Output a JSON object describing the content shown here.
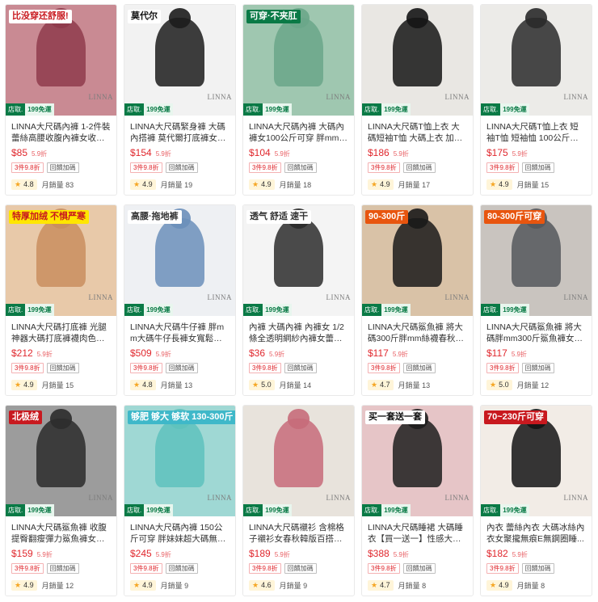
{
  "shop_badge": {
    "prefix": "店取.",
    "suffix": "199免運"
  },
  "watermark": "LINNA",
  "sold_prefix": "月銷量",
  "products": [
    {
      "title": "LINNA大尺碼內褲 1-2件裝 蕾絲高腰收腹內褲女收小肚...",
      "price": "$85",
      "discount": "5.9折",
      "tags": [
        "3件9.8折",
        "回饋加碼"
      ],
      "rating": "4.8",
      "sold": "83",
      "promo": "比没穿还舒服!",
      "bg": "#c98a93",
      "fg": "#8f3b4c",
      "promo_bg": "#ffffff",
      "promo_fg": "#c8191f"
    },
    {
      "title": "LINNA大尺碼緊身褲 大碼內搭褲 莫代爾打底褲女新款夏...",
      "price": "$154",
      "discount": "5.9折",
      "tags": [
        "3件9.8折",
        "回饋加碼"
      ],
      "rating": "4.9",
      "sold": "19",
      "promo": "莫代尔",
      "bg": "#f2f2f2",
      "fg": "#1c1c1c",
      "promo_bg": "#ffffff",
      "promo_fg": "#111111"
    },
    {
      "title": "LINNA大尺碼內褲 大碼內褲女100公斤可穿 胖mm夏季...",
      "price": "$104",
      "discount": "5.9折",
      "tags": [
        "3件9.8折",
        "回饋加碼"
      ],
      "rating": "4.9",
      "sold": "18",
      "promo": "可穿·不夹肛",
      "bg": "#9fc7b0",
      "fg": "#6aa68a",
      "promo_bg": "#0a7a46",
      "promo_fg": "#ffffff"
    },
    {
      "title": "LINNA大尺碼T恤上衣 大碼短袖T恤 大碼上衣 加大短袖...",
      "price": "$186",
      "discount": "5.9折",
      "tags": [
        "3件9.8折",
        "回饋加碼"
      ],
      "rating": "4.9",
      "sold": "17",
      "promo": "",
      "bg": "#e9e7e3",
      "fg": "#151515",
      "promo_bg": "#ffffff",
      "promo_fg": "#111111"
    },
    {
      "title": "LINNA大尺碼T恤上衣 短袖T恤 短袖恤 100公斤將大碼寬...",
      "price": "$175",
      "discount": "5.9折",
      "tags": [
        "3件9.8折",
        "回饋加碼"
      ],
      "rating": "4.9",
      "sold": "15",
      "promo": "",
      "bg": "#ecebe8",
      "fg": "#2a2a2a",
      "promo_bg": "#ffffff",
      "promo_fg": "#111111"
    },
    {
      "title": "LINNA大尺碼打底褲 光腿神器大碼打底褲襪肉色不規則...",
      "price": "$212",
      "discount": "5.9折",
      "tags": [
        "3件9.8折",
        "回饋加碼"
      ],
      "rating": "4.9",
      "sold": "15",
      "promo": "特厚加绒 不惧严寒",
      "bg": "#e8c9a9",
      "fg": "#c98e5f",
      "promo_bg": "#ffe600",
      "promo_fg": "#c8191f"
    },
    {
      "title": "LINNA大尺碼牛仔褲 胖mm大碼牛仔長褲女寬鬆顯高...",
      "price": "$509",
      "discount": "5.9折",
      "tags": [
        "3件9.8折",
        "回饋加碼"
      ],
      "rating": "4.8",
      "sold": "13",
      "promo": "高腰·拖地裤",
      "bg": "#eef0f3",
      "fg": "#6b8fba",
      "promo_bg": "#ffffff",
      "promo_fg": "#333333"
    },
    {
      "title": "內褲 大碼內褲 內褲女 1/2條全透明網紗內褲女蕾絲超...",
      "price": "$36",
      "discount": "5.9折",
      "tags": [
        "3件9.8折",
        "回饋加碼"
      ],
      "rating": "5.0",
      "sold": "14",
      "promo": "透气 舒适 速干",
      "bg": "#f4f4f4",
      "fg": "#2b2b2b",
      "promo_bg": "#ffffff",
      "promo_fg": "#333333"
    },
    {
      "title": "LINNA大尺碼鯊魚褲 將大碼300斤胖mm絲襪春秋薄款...",
      "price": "$117",
      "discount": "5.9折",
      "tags": [
        "3件9.8折",
        "回饋加碼"
      ],
      "rating": "4.7",
      "sold": "13",
      "promo": "90-300斤",
      "bg": "#d9c2a7",
      "fg": "#1a1a1a",
      "promo_bg": "#e8550f",
      "promo_fg": "#ffffff"
    },
    {
      "title": "LINNA大尺碼鯊魚褲 將大碼胖mm300斤鯊魚褲女外穿...",
      "price": "$117",
      "discount": "5.9折",
      "tags": [
        "3件9.8折",
        "回饋加碼"
      ],
      "rating": "5.0",
      "sold": "12",
      "promo": "80-300斤可穿",
      "bg": "#c9c4bf",
      "fg": "#55585c",
      "promo_bg": "#e8550f",
      "promo_fg": "#ffffff"
    },
    {
      "title": "LINNA大尺碼鯊魚褲 收腹提臀翻瘦彈力鯊魚褲女春夏...",
      "price": "$159",
      "discount": "5.9折",
      "tags": [
        "3件9.8折",
        "回饋加碼"
      ],
      "rating": "4.9",
      "sold": "12",
      "promo": "北极绒",
      "bg": "#9c9c9c",
      "fg": "#2c2c2c",
      "promo_bg": "#c8191f",
      "promo_fg": "#ffffff"
    },
    {
      "title": "LINNA大尺碼內褲 150公斤可穿 胖妹妹超大碼無痕莫...",
      "price": "$245",
      "discount": "5.9折",
      "tags": [
        "3件9.8折",
        "回饋加碼"
      ],
      "rating": "4.9",
      "sold": "9",
      "promo": "够肥 够大 够软 130-300斤",
      "bg": "#9fd8d4",
      "fg": "#5ec2bd",
      "promo_bg": "#3fb8c9",
      "promo_fg": "#ffffff"
    },
    {
      "title": "LINNA大尺碼襯衫 含棉格子襯衫女春秋韓版百搭上衣...",
      "price": "$189",
      "discount": "5.9折",
      "tags": [
        "3件9.8折",
        "回饋加碼"
      ],
      "rating": "4.6",
      "sold": "9",
      "promo": "",
      "bg": "#e8e3dc",
      "fg": "#c76b7a",
      "promo_bg": "#ffffff",
      "promo_fg": "#111111"
    },
    {
      "title": "LINNA大尺碼睡裙 大碼睡衣【買一送一】性感大碼網...",
      "price": "$388",
      "discount": "5.9折",
      "tags": [
        "3件9.8折",
        "回饋加碼"
      ],
      "rating": "4.7",
      "sold": "8",
      "promo": "买一套送一套",
      "bg": "#e6c5c7",
      "fg": "#1d1d1d",
      "promo_bg": "#ffffff",
      "promo_fg": "#111111"
    },
    {
      "title": "內衣 蕾絲內衣 大碼冰絲內衣女聚攏無痕E無鋼圈睡...",
      "price": "$182",
      "discount": "5.9折",
      "tags": [
        "3件9.8折",
        "回饋加碼"
      ],
      "rating": "4.9",
      "sold": "8",
      "promo": "70~230斤可穿",
      "bg": "#f2ece6",
      "fg": "#141414",
      "promo_bg": "#c8191f",
      "promo_fg": "#ffffff"
    }
  ]
}
